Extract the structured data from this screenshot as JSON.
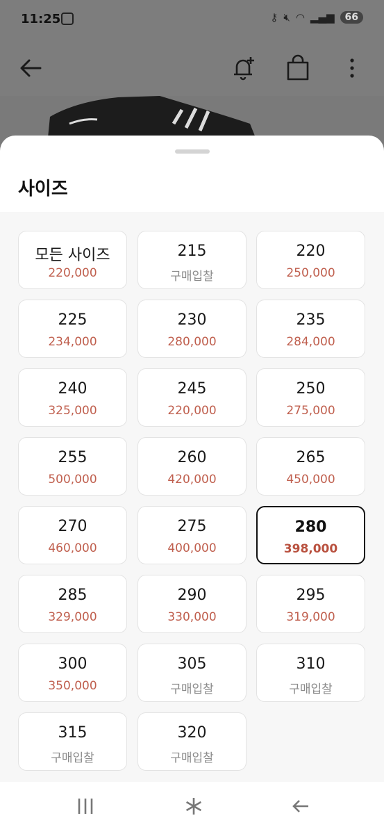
{
  "status_bar": {
    "time": "11:25",
    "battery": "66"
  },
  "sheet": {
    "title": "사이즈"
  },
  "sizes": [
    {
      "size": "모든 사이즈",
      "price": "220,000",
      "bid": false,
      "selected": false
    },
    {
      "size": "215",
      "price": "구매입찰",
      "bid": true,
      "selected": false
    },
    {
      "size": "220",
      "price": "250,000",
      "bid": false,
      "selected": false
    },
    {
      "size": "225",
      "price": "234,000",
      "bid": false,
      "selected": false
    },
    {
      "size": "230",
      "price": "280,000",
      "bid": false,
      "selected": false
    },
    {
      "size": "235",
      "price": "284,000",
      "bid": false,
      "selected": false
    },
    {
      "size": "240",
      "price": "325,000",
      "bid": false,
      "selected": false
    },
    {
      "size": "245",
      "price": "220,000",
      "bid": false,
      "selected": false
    },
    {
      "size": "250",
      "price": "275,000",
      "bid": false,
      "selected": false
    },
    {
      "size": "255",
      "price": "500,000",
      "bid": false,
      "selected": false
    },
    {
      "size": "260",
      "price": "420,000",
      "bid": false,
      "selected": false
    },
    {
      "size": "265",
      "price": "450,000",
      "bid": false,
      "selected": false
    },
    {
      "size": "270",
      "price": "460,000",
      "bid": false,
      "selected": false
    },
    {
      "size": "275",
      "price": "400,000",
      "bid": false,
      "selected": false
    },
    {
      "size": "280",
      "price": "398,000",
      "bid": false,
      "selected": true
    },
    {
      "size": "285",
      "price": "329,000",
      "bid": false,
      "selected": false
    },
    {
      "size": "290",
      "price": "330,000",
      "bid": false,
      "selected": false
    },
    {
      "size": "295",
      "price": "319,000",
      "bid": false,
      "selected": false
    },
    {
      "size": "300",
      "price": "350,000",
      "bid": false,
      "selected": false
    },
    {
      "size": "305",
      "price": "구매입찰",
      "bid": true,
      "selected": false
    },
    {
      "size": "310",
      "price": "구매입찰",
      "bid": true,
      "selected": false
    },
    {
      "size": "315",
      "price": "구매입찰",
      "bid": true,
      "selected": false
    },
    {
      "size": "320",
      "price": "구매입찰",
      "bid": true,
      "selected": false
    }
  ],
  "colors": {
    "price": "#c0604f",
    "bid_text": "#8a8a8a",
    "selected_border": "#111111"
  }
}
